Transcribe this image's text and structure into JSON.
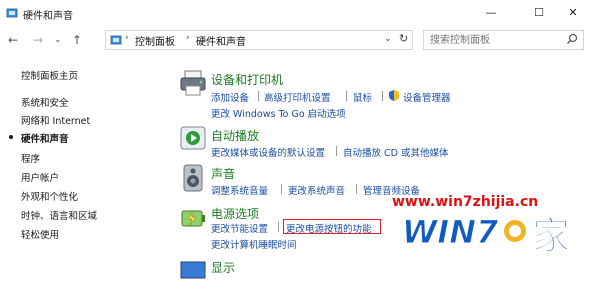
{
  "window": {
    "title": "硬件和声音",
    "minimize": "—",
    "maximize": "☐",
    "close": "✕"
  },
  "nav": {
    "back": "←",
    "forward": "→",
    "up": "↑",
    "dropdown": "⌄",
    "refresh": "↻"
  },
  "address": {
    "crumbs": [
      "控制面板",
      "硬件和声音"
    ]
  },
  "search": {
    "placeholder": "搜索控制面板"
  },
  "sidebar": {
    "items": [
      "控制面板主页",
      "系统和安全",
      "网络和 Internet",
      "硬件和声音",
      "程序",
      "用户帐户",
      "外观和个性化",
      "时钟、语言和区域",
      "轻松使用"
    ],
    "active_index": 3
  },
  "categories": [
    {
      "title": "设备和打印机",
      "icon": "printer-icon",
      "links": [
        "添加设备",
        "高级打印机设置",
        "鼠标",
        "设备管理器",
        "更改 Windows To Go 启动选项"
      ]
    },
    {
      "title": "自动播放",
      "icon": "autoplay-icon",
      "links": [
        "更改媒体或设备的默认设置",
        "自动播放 CD 或其他媒体"
      ]
    },
    {
      "title": "声音",
      "icon": "speaker-icon",
      "links": [
        "调整系统音量",
        "更改系统声音",
        "管理音频设备"
      ]
    },
    {
      "title": "电源选项",
      "icon": "power-icon",
      "links": [
        "更改节能设置",
        "更改电源按钮的功能",
        "更改计算机睡眠时间"
      ]
    },
    {
      "title": "显示",
      "icon": "display-icon",
      "links": []
    }
  ],
  "watermark": {
    "url": "www.win7zhijia.cn",
    "brand": "WIN7",
    "suffix": "家"
  },
  "colors": {
    "title_green": "#1e7c24",
    "link_blue": "#1a4fa3",
    "highlight_red": "#e02020"
  }
}
